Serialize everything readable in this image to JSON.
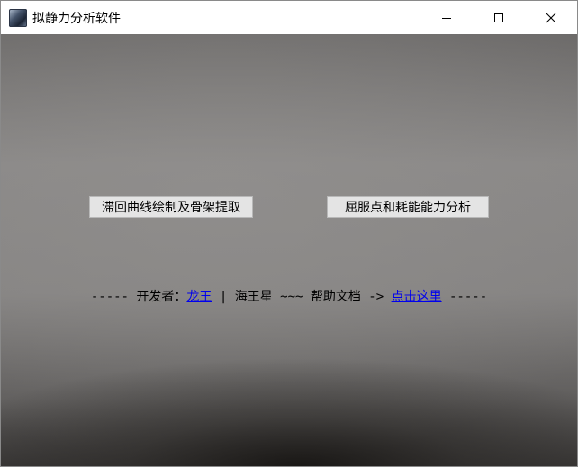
{
  "window": {
    "title": "拟静力分析软件",
    "icon": "app-icon"
  },
  "controls": {
    "minimize": "minimize-icon",
    "maximize": "maximize-icon",
    "close": "close-icon"
  },
  "buttons": {
    "hysteresis": "滞回曲线绘制及骨架提取",
    "yield": "屈服点和耗能能力分析"
  },
  "footer": {
    "prefix": "----- 开发者：",
    "developer_link": "龙王",
    "middle": " | 海王星 ~~~ 帮助文档 -> ",
    "help_link": "点击这里",
    "suffix": " -----",
    "link_color": "#0000ee"
  }
}
